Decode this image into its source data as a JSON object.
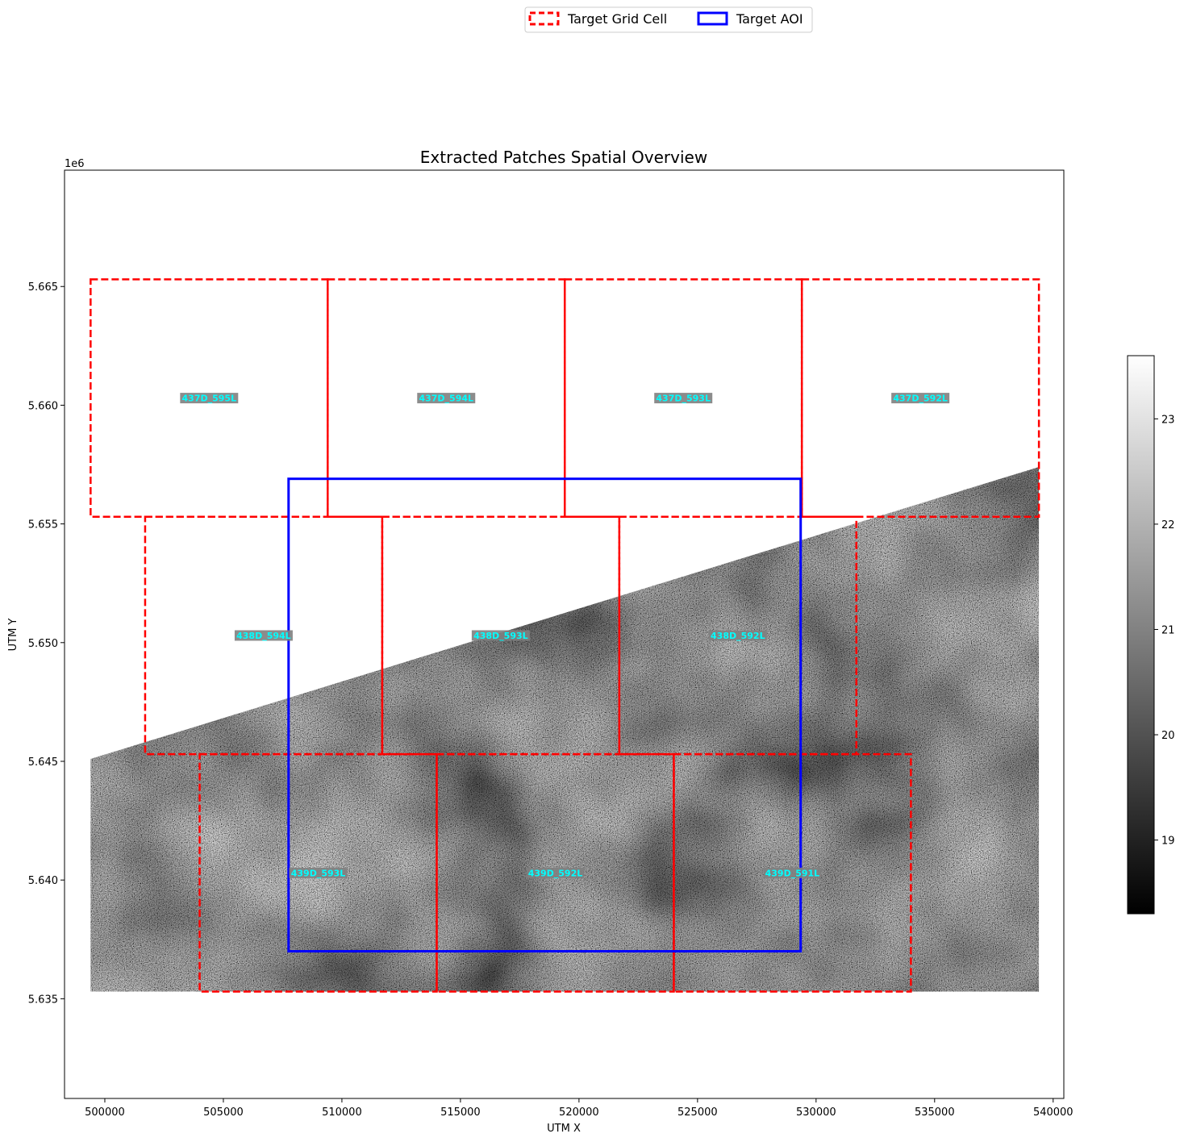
{
  "chart_data": {
    "type": "map",
    "title": "Extracted Patches Spatial Overview",
    "xlabel": "UTM X",
    "ylabel": "UTM Y",
    "y_offset_text": "1e6",
    "xlim": [
      498300,
      540450
    ],
    "ylim": [
      5630800,
      5669900
    ],
    "x_ticks": [
      500000,
      505000,
      510000,
      515000,
      520000,
      525000,
      530000,
      535000,
      540000
    ],
    "y_ticks": [
      5635000,
      5640000,
      5645000,
      5650000,
      5655000,
      5660000,
      5665000
    ],
    "y_tick_labels": [
      "5.635",
      "5.640",
      "5.645",
      "5.650",
      "5.655",
      "5.660",
      "5.665"
    ],
    "legend": {
      "placement": "top-center, above plot",
      "entries": [
        {
          "label": "Target Grid Cell",
          "color": "#ff0000",
          "style": "dashed"
        },
        {
          "label": "Target AOI",
          "color": "#0000ff",
          "style": "solid"
        }
      ]
    },
    "raster": {
      "description_colormap": "gray",
      "extent": {
        "x": [
          499400,
          539400
        ],
        "y": [
          5635300,
          5665300
        ]
      },
      "valid_edge": {
        "x0": 499400,
        "y0": 5645100,
        "x1": 539400,
        "y1": 5657400
      }
    },
    "colorbar": {
      "range": [
        18.3,
        23.6
      ],
      "ticks": [
        19,
        20,
        21,
        22,
        23
      ]
    },
    "grid_cells": [
      {
        "label": "437D_595L",
        "x": [
          499400,
          509400
        ],
        "y": [
          5655300,
          5665300
        ]
      },
      {
        "label": "437D_594L",
        "x": [
          509400,
          519400
        ],
        "y": [
          5655300,
          5665300
        ]
      },
      {
        "label": "437D_593L",
        "x": [
          519400,
          529400
        ],
        "y": [
          5655300,
          5665300
        ]
      },
      {
        "label": "437D_592L",
        "x": [
          529400,
          539400
        ],
        "y": [
          5655300,
          5665300
        ]
      },
      {
        "label": "438D_594L",
        "x": [
          501700,
          511700
        ],
        "y": [
          5645300,
          5655300
        ]
      },
      {
        "label": "438D_593L",
        "x": [
          511700,
          521700
        ],
        "y": [
          5645300,
          5655300
        ]
      },
      {
        "label": "438D_592L",
        "x": [
          521700,
          531700
        ],
        "y": [
          5645300,
          5655300
        ]
      },
      {
        "label": "439D_593L",
        "x": [
          504000,
          514000
        ],
        "y": [
          5635300,
          5645300
        ]
      },
      {
        "label": "439D_592L",
        "x": [
          514000,
          524000
        ],
        "y": [
          5635300,
          5645300
        ]
      },
      {
        "label": "439D_591L",
        "x": [
          524000,
          534000
        ],
        "y": [
          5635300,
          5645300
        ]
      }
    ],
    "aoi": {
      "x": [
        507750,
        529350
      ],
      "y": [
        5637000,
        5656900
      ]
    },
    "colors": {
      "grid_cell": "#ff0000",
      "aoi": "#0000ff",
      "label_text": "#00ffff",
      "label_box": "#808080"
    }
  }
}
